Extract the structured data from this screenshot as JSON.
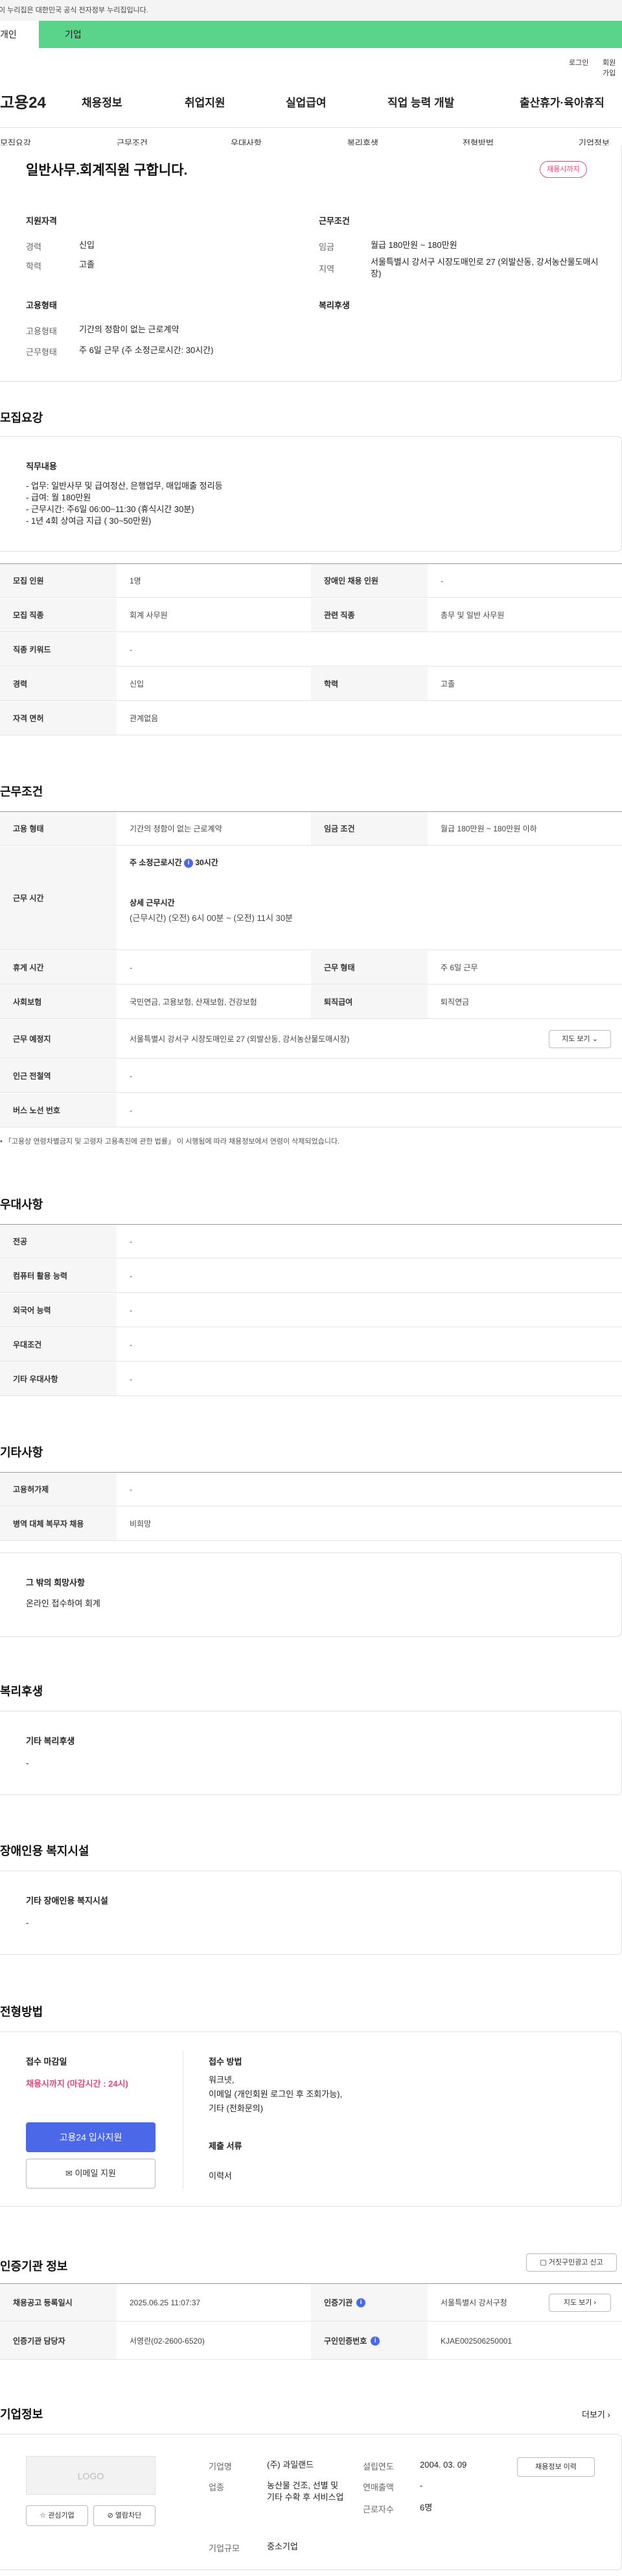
{
  "gov_notice": "이 누리집은 대한민국 공식 전자정부 누리집입니다.",
  "top_tabs": {
    "individual": "개인",
    "corporate": "기업"
  },
  "util": {
    "login": "로그인",
    "join": "회원가입"
  },
  "logo": "고용24",
  "gnb": [
    "채용정보",
    "취업지원",
    "실업급여",
    "직업 능력 개발",
    "출산휴가·육아휴직"
  ],
  "snb": [
    "모집요강",
    "근무조건",
    "우대사항",
    "복리후생",
    "전형방법",
    "기업정보"
  ],
  "summary": {
    "title": "일반사무.회계직원 구합니다.",
    "badge": "채용시까지",
    "qual_title": "지원자격",
    "qual": [
      {
        "label": "경력",
        "value": "신입"
      },
      {
        "label": "학력",
        "value": "고졸"
      }
    ],
    "cond_title": "근무조건",
    "cond": [
      {
        "label": "임금",
        "value": "월급 180만원 ~ 180만원"
      },
      {
        "label": "지역",
        "value": "서울특별시 강서구 시장도매인로 27 (외발산동, 강서농산물도매시장)"
      }
    ],
    "emp_title": "고용형태",
    "emp": [
      {
        "label": "고용형태",
        "value": "기간의 정함이 없는 근로계약"
      },
      {
        "label": "근무형태",
        "value": "주 6일 근무 (주 소정근로시간: 30시간)"
      }
    ],
    "welfare_title": "복리후생"
  },
  "recruit": {
    "heading": "모집요강",
    "duty_title": "직무내용",
    "duty_lines": [
      "- 업무: 일반사무 및 급여정산, 은행업무, 매입매출 정리등",
      "- 급여: 월 180만원",
      "- 근무시간: 주6일 06:00~11:30 (휴식시간 30분)",
      "- 1년 4회 상여금 지급 ( 30~50만원)"
    ],
    "rows": [
      [
        {
          "th": "모집 인원",
          "td": "1명"
        },
        {
          "th": "장애인 채용 인원",
          "td": "-"
        }
      ],
      [
        {
          "th": "모집 직종",
          "td": "회계 사무원"
        },
        {
          "th": "관련 직종",
          "td": "총무 및 일반 사무원"
        }
      ],
      [
        {
          "th": "직종 키워드",
          "td": "-"
        }
      ],
      [
        {
          "th": "경력",
          "td": "신입"
        },
        {
          "th": "학력",
          "td": "고졸"
        }
      ],
      [
        {
          "th": "자격 면허",
          "td": "관계없음"
        }
      ]
    ]
  },
  "work": {
    "heading": "근무조건",
    "row1": [
      {
        "th": "고용 형태",
        "td": "기간의 정함이 없는 근로계약"
      },
      {
        "th": "임금 조건",
        "td": "월급 180만원 ~ 180만원 이하"
      }
    ],
    "time_th": "근무 시간",
    "time_main": "주 소정근로시간",
    "time_hours": "30시간",
    "time_detail_title": "상세 근무시간",
    "time_detail": "(근무시간) (오전) 6시 00분 ~ (오전) 11시 30분",
    "row3": [
      {
        "th": "휴게 시간",
        "td": "-"
      },
      {
        "th": "근무 형태",
        "td": "주 6일 근무"
      }
    ],
    "row4": [
      {
        "th": "사회보험",
        "td": "국민연금, 고용보험, 산재보험, 건강보험"
      },
      {
        "th": "퇴직급여",
        "td": "퇴직연금"
      }
    ],
    "loc_th": "근무 예정지",
    "loc_td": "서울특별시 강서구 시장도매인로 27 (외발산동, 강서농산물도매시장)",
    "map_btn": "지도 보기",
    "row6": {
      "th": "인근 전철역",
      "td": "-"
    },
    "row7": {
      "th": "버스 노선 번호",
      "td": "-"
    },
    "notice": "「고용상 연령차별금지 및 고령자 고용촉진에 관한 법률」 이 시행됨에 따라 채용정보에서 연령이 삭제되었습니다."
  },
  "pref": {
    "heading": "우대사항",
    "rows": [
      {
        "th": "전공",
        "td": "-"
      },
      {
        "th": "컴퓨터 활용 능력",
        "td": "-"
      },
      {
        "th": "외국어 능력",
        "td": "-"
      },
      {
        "th": "우대조건",
        "td": "-"
      },
      {
        "th": "기타 우대사항",
        "td": "-"
      }
    ]
  },
  "other": {
    "heading": "기타사항",
    "rows": [
      {
        "th": "고용허가제",
        "td": "-"
      },
      {
        "th": "병역 대체 복무자 채용",
        "td": "비희망"
      }
    ],
    "wish_title": "그 밖의 희망사항",
    "wish_text": "온라인 접수하여 회계"
  },
  "welfare": {
    "heading": "복리후생",
    "box_title": "기타 복리후생",
    "box_text": "-"
  },
  "disabled": {
    "heading": "장애인용 복지시설",
    "box_title": "기타 장애인용 복지시설",
    "box_text": "-"
  },
  "process": {
    "heading": "전형방법",
    "deadline_title": "접수 마감일",
    "deadline_value": "채용시까지 (마감시간 : 24시)",
    "apply_btn": "고용24 입사지원",
    "email_btn": "이메일 지원",
    "method_title": "접수 방법",
    "method_lines": [
      "워크넷,",
      "이메일 (개인회원 로그인 후 조회가능),",
      "기타 (전화문의)"
    ],
    "docs_title": "제출 서류",
    "docs_value": "이력서"
  },
  "cert": {
    "heading": "인증기관 정보",
    "report_btn": "거짓구인광고 신고",
    "row1": [
      {
        "th": "채용공고 등록일시",
        "td": "2025.06.25 11:07:37"
      },
      {
        "th": "인증기관",
        "td": "서울특별시 강서구청"
      }
    ],
    "row2": [
      {
        "th": "인증기관 담당자",
        "td": "서영란(02-2600-6520)"
      },
      {
        "th": "구인인증번호",
        "td": "KJAE002506250001"
      }
    ],
    "map_btn": "지도 보기"
  },
  "company": {
    "heading": "기업정보",
    "more": "더보기",
    "logo_text": "LOGO",
    "fav_btn": "관심기업",
    "block_btn": "열람차단",
    "fields_left": [
      {
        "label": "기업명",
        "value": "(주) 과일랜드"
      },
      {
        "label": "업종",
        "value": "농산물 건조, 선별 및 기타 수확 후 서비스업"
      },
      {
        "label": "기업규모",
        "value": "중소기업"
      }
    ],
    "fields_right": [
      {
        "label": "설립연도",
        "value": "2004. 03. 09"
      },
      {
        "label": "연매출액",
        "value": "-"
      },
      {
        "label": "근로자수",
        "value": "6명"
      }
    ],
    "history_btn": "채용정보 이력"
  }
}
